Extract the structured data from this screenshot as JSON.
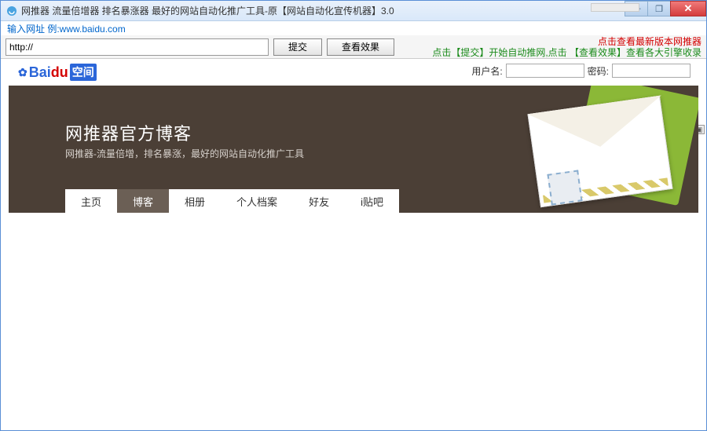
{
  "window": {
    "title": "网推器 流量倍增器 排名暴涨器 最好的网站自动化推广工具-原【网站自动化宣传机器】3.0"
  },
  "hint": "输入网址 例:www.baidu.com",
  "url_value": "http://",
  "buttons": {
    "submit": "提交",
    "view_effect": "查看效果"
  },
  "top_right": {
    "line1": "点击查看最新版本网推器",
    "line2_a": "点击【提交】开始自动推网,点击 【查看效果】查看各大引擎收录"
  },
  "login": {
    "user_label": "用户名:",
    "pass_label": "密码:"
  },
  "logo": {
    "bai": "Bai",
    "du": "du",
    "space": "空间",
    "back_brand": "Baidu"
  },
  "banner": {
    "title": "网推器官方博客",
    "subtitle": "网推器-流量倍增，排名暴涨，最好的网站自动化推广工具"
  },
  "nav": [
    {
      "label": "主页",
      "active": false
    },
    {
      "label": "博客",
      "active": true
    },
    {
      "label": "相册",
      "active": false
    },
    {
      "label": "个人档案",
      "active": false
    },
    {
      "label": "好友",
      "active": false
    },
    {
      "label": "i贴吧",
      "active": false
    }
  ]
}
